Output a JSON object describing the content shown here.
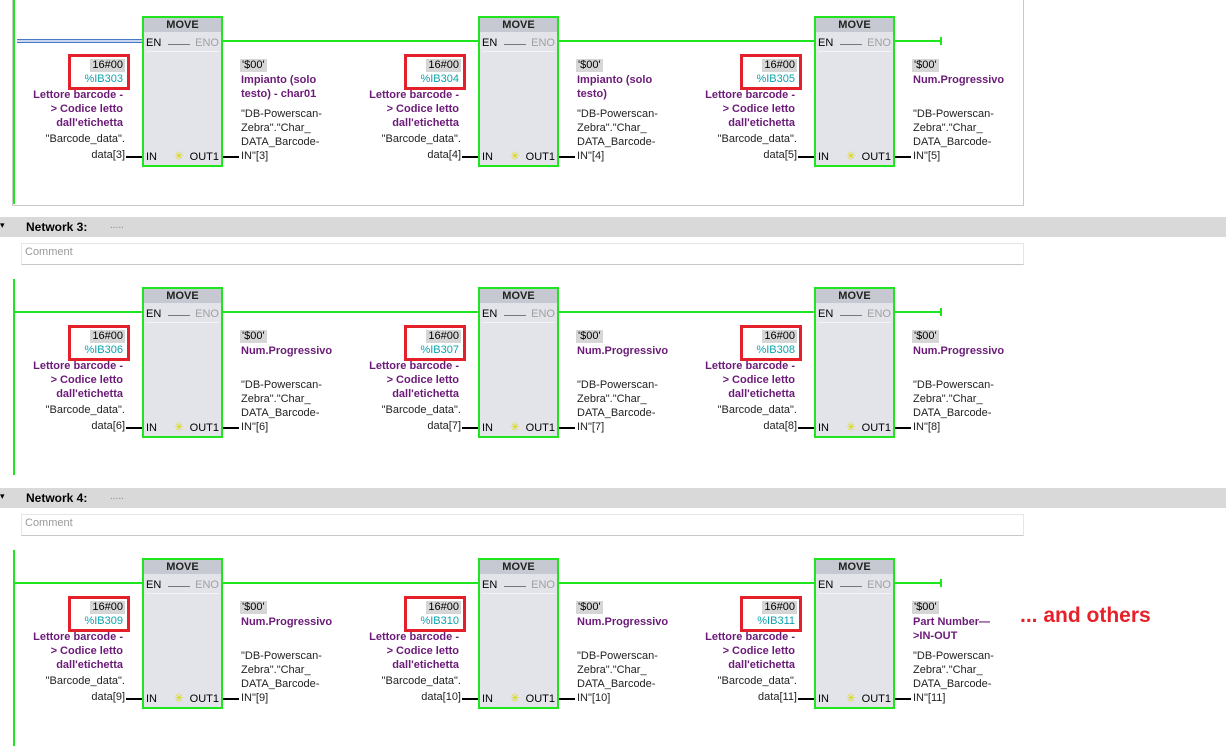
{
  "networks": [
    {
      "title": "",
      "description": "",
      "comment_placeholder": "",
      "selected_first_wire": true,
      "blocks": [
        {
          "name": "MOVE",
          "en": "EN",
          "eno": "ENO",
          "in": "IN",
          "out": "OUT1",
          "in_const": "16#00",
          "in_addr": "%IB303",
          "in_symbol": [
            "Lettore barcode -",
            "> Codice letto",
            "dall'etichetta"
          ],
          "in_operand": [
            "\"Barcode_data\".",
            "data[3]"
          ],
          "out_const": "'$00'",
          "out_symbol": [
            "Impianto (solo",
            "testo) - char01"
          ],
          "out_operand": [
            "\"DB-Powerscan-",
            "Zebra\".\"Char_",
            "DATA_Barcode-",
            "IN\"[3]"
          ]
        },
        {
          "name": "MOVE",
          "en": "EN",
          "eno": "ENO",
          "in": "IN",
          "out": "OUT1",
          "in_const": "16#00",
          "in_addr": "%IB304",
          "in_symbol": [
            "Lettore barcode -",
            "> Codice letto",
            "dall'etichetta"
          ],
          "in_operand": [
            "\"Barcode_data\".",
            "data[4]"
          ],
          "out_const": "'$00'",
          "out_symbol": [
            "Impianto (solo",
            "testo)"
          ],
          "out_operand": [
            "\"DB-Powerscan-",
            "Zebra\".\"Char_",
            "DATA_Barcode-",
            "IN\"[4]"
          ]
        },
        {
          "name": "MOVE",
          "en": "EN",
          "eno": "ENO",
          "in": "IN",
          "out": "OUT1",
          "in_const": "16#00",
          "in_addr": "%IB305",
          "in_symbol": [
            "Lettore barcode -",
            "> Codice letto",
            "dall'etichetta"
          ],
          "in_operand": [
            "\"Barcode_data\".",
            "data[5]"
          ],
          "out_const": "'$00'",
          "out_symbol": [
            "Num.Progressivo"
          ],
          "out_operand": [
            "\"DB-Powerscan-",
            "Zebra\".\"Char_",
            "DATA_Barcode-",
            "IN\"[5]"
          ]
        }
      ]
    },
    {
      "title": "Network 3:",
      "description": ".....",
      "comment_placeholder": "Comment",
      "blocks": [
        {
          "name": "MOVE",
          "en": "EN",
          "eno": "ENO",
          "in": "IN",
          "out": "OUT1",
          "in_const": "16#00",
          "in_addr": "%IB306",
          "in_symbol": [
            "Lettore barcode -",
            "> Codice letto",
            "dall'etichetta"
          ],
          "in_operand": [
            "\"Barcode_data\".",
            "data[6]"
          ],
          "out_const": "'$00'",
          "out_symbol": [
            "Num.Progressivo"
          ],
          "out_operand": [
            "\"DB-Powerscan-",
            "Zebra\".\"Char_",
            "DATA_Barcode-",
            "IN\"[6]"
          ]
        },
        {
          "name": "MOVE",
          "en": "EN",
          "eno": "ENO",
          "in": "IN",
          "out": "OUT1",
          "in_const": "16#00",
          "in_addr": "%IB307",
          "in_symbol": [
            "Lettore barcode -",
            "> Codice letto",
            "dall'etichetta"
          ],
          "in_operand": [
            "\"Barcode_data\".",
            "data[7]"
          ],
          "out_const": "'$00'",
          "out_symbol": [
            "Num.Progressivo"
          ],
          "out_operand": [
            "\"DB-Powerscan-",
            "Zebra\".\"Char_",
            "DATA_Barcode-",
            "IN\"[7]"
          ]
        },
        {
          "name": "MOVE",
          "en": "EN",
          "eno": "ENO",
          "in": "IN",
          "out": "OUT1",
          "in_const": "16#00",
          "in_addr": "%IB308",
          "in_symbol": [
            "Lettore barcode -",
            "> Codice letto",
            "dall'etichetta"
          ],
          "in_operand": [
            "\"Barcode_data\".",
            "data[8]"
          ],
          "out_const": "'$00'",
          "out_symbol": [
            "Num.Progressivo"
          ],
          "out_operand": [
            "\"DB-Powerscan-",
            "Zebra\".\"Char_",
            "DATA_Barcode-",
            "IN\"[8]"
          ]
        }
      ]
    },
    {
      "title": "Network 4:",
      "description": ".....",
      "comment_placeholder": "Comment",
      "blocks": [
        {
          "name": "MOVE",
          "en": "EN",
          "eno": "ENO",
          "in": "IN",
          "out": "OUT1",
          "in_const": "16#00",
          "in_addr": "%IB309",
          "in_symbol": [
            "Lettore barcode -",
            "> Codice letto",
            "dall'etichetta"
          ],
          "in_operand": [
            "\"Barcode_data\".",
            "data[9]"
          ],
          "out_const": "'$00'",
          "out_symbol": [
            "Num.Progressivo"
          ],
          "out_operand": [
            "\"DB-Powerscan-",
            "Zebra\".\"Char_",
            "DATA_Barcode-",
            "IN\"[9]"
          ]
        },
        {
          "name": "MOVE",
          "en": "EN",
          "eno": "ENO",
          "in": "IN",
          "out": "OUT1",
          "in_const": "16#00",
          "in_addr": "%IB310",
          "in_symbol": [
            "Lettore barcode -",
            "> Codice letto",
            "dall'etichetta"
          ],
          "in_operand": [
            "\"Barcode_data\".",
            "data[10]"
          ],
          "out_const": "'$00'",
          "out_symbol": [
            "Num.Progressivo"
          ],
          "out_operand": [
            "\"DB-Powerscan-",
            "Zebra\".\"Char_",
            "DATA_Barcode-",
            "IN\"[10]"
          ]
        },
        {
          "name": "MOVE",
          "en": "EN",
          "eno": "ENO",
          "in": "IN",
          "out": "OUT1",
          "in_const": "16#00",
          "in_addr": "%IB311",
          "in_symbol": [
            "Lettore barcode -",
            "> Codice letto",
            "dall'etichetta"
          ],
          "in_operand": [
            "\"Barcode_data\".",
            "data[11]"
          ],
          "out_const": "'$00'",
          "out_symbol": [
            "Part Number—",
            ">IN-OUT"
          ],
          "out_operand": [
            "\"DB-Powerscan-",
            "Zebra\".\"Char_",
            "DATA_Barcode-",
            "IN\"[11]"
          ]
        }
      ]
    }
  ],
  "annotation": "... and others",
  "colors": {
    "wire": "#1fe51f",
    "highlight_box": "#e4202b",
    "address": "#0aa5ad",
    "symbol": "#6b1a78"
  }
}
